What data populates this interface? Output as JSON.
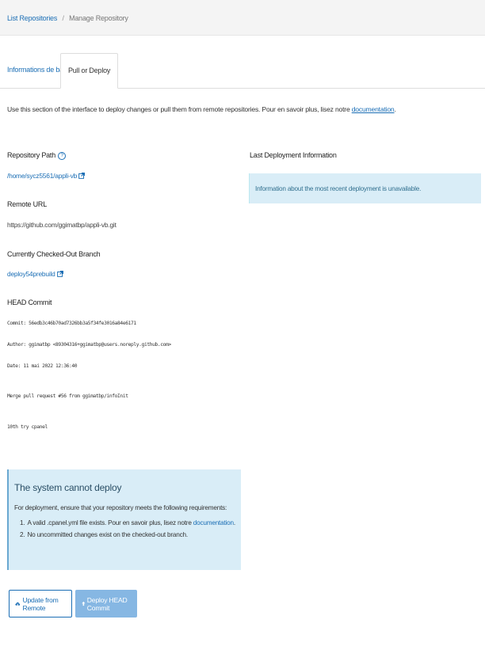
{
  "breadcrumb": {
    "parent": "List Repositories",
    "separator": "/",
    "current": "Manage Repository"
  },
  "tabs": [
    {
      "label": "Informations de base"
    },
    {
      "label": "Pull or Deploy"
    }
  ],
  "intro": {
    "text": "Use this section of the interface to deploy changes or pull them from remote repositories. Pour en savoir plus, lisez notre ",
    "link": "documentation",
    "end": "."
  },
  "repo_path": {
    "label": "Repository Path",
    "value": "/home/sycz5561/appli-vb"
  },
  "remote_url": {
    "label": "Remote URL",
    "value": "https://github.com/ggimatbp/appli-vb.git"
  },
  "branch": {
    "label": "Currently Checked-Out Branch",
    "value": "deploy54prebuild"
  },
  "head_commit": {
    "label": "HEAD Commit",
    "commit": "Commit: 56edb3c46b70ad7326bb3a5f34fe3016a84e6171",
    "author": "Author: ggimatbp <89304316+ggimatbp@users.noreply.github.com>",
    "date": "Date: 11 mai 2022 12:36:40",
    "message1": "Merge pull request #56 from ggimatbp/infoInit",
    "message2": "10th try cpanel"
  },
  "last_deployment": {
    "label": "Last Deployment Information",
    "info": "Information about the most recent deployment is unavailable."
  },
  "cannot_deploy": {
    "title": "The system cannot deploy",
    "description": "For deployment, ensure that your repository meets the following requirements:",
    "items": [
      {
        "num": "1.",
        "text": "A valid .cpanel.yml file exists. Pour en savoir plus, lisez notre ",
        "link": "documentation",
        "end": "."
      },
      {
        "num": "2.",
        "text": "No uncommitted changes exist on the checked-out branch."
      }
    ]
  },
  "buttons": {
    "update": "Update from Remote",
    "deploy": "Deploy HEAD Commit"
  },
  "colors": {
    "link": "#1b6eb5",
    "info_bg": "#d9edf7",
    "deploy_btn": "#86b7e3"
  },
  "icons": {
    "help": "question-circle-icon",
    "external": "external-link-icon",
    "update": "cloud-download-icon",
    "deploy": "upload-arrow-icon"
  }
}
